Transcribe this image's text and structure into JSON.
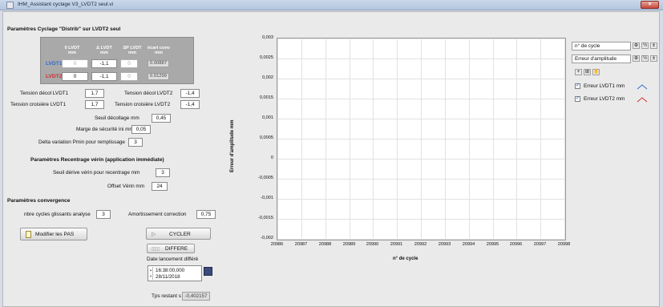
{
  "window": {
    "title": "IHM_Assistant cyclage V3_LVDT2 seul.vi",
    "close_glyph": "×"
  },
  "cycle": {
    "title": "Paramètres Cyclage \"Distrib\" sur LVDT2 seul",
    "table": {
      "headers": [
        "0 LVDT mm",
        "Δ LVDT mm",
        "SP LVDT mm",
        "écart conv mm"
      ],
      "rows": [
        {
          "label": "LVDT1",
          "zero": "0",
          "delta": "-1,1",
          "sp": "0",
          "ecart": "0.00887"
        },
        {
          "label": "LVDT2",
          "zero": "0",
          "delta": "-1,1",
          "sp": "0",
          "ecart": "0.01299"
        }
      ]
    },
    "tension_decol_1_label": "Tension décol LVDT1",
    "tension_decol_1": "1,7",
    "tension_decol_2_label": "Tension décol LVDT2",
    "tension_decol_2": "-1,4",
    "tension_crois_1_label": "Tension croisière LVDT1",
    "tension_crois_1": "1,7",
    "tension_crois_2_label": "Tension croisière LVDT2",
    "tension_crois_2": "-1,4",
    "seuil_label": "Seuil décollage mm",
    "seuil": "0,45",
    "marge_label": "Marge de sécurité ini mm",
    "marge": "0,05",
    "delta_label": "Delta variation Pmin pour remplissage",
    "delta": "3"
  },
  "verin": {
    "title": "Paramètres Recentrage vérin (application immédiate)",
    "seuil_label": "Seuil dérive vérin pour recentrage mm",
    "seuil": "3",
    "offset_label": "Offset Vérin mm",
    "offset": "24"
  },
  "convergence": {
    "title": "Paramètres convergence",
    "nbre_label": "nbre cycles glissants analyse",
    "nbre": "3",
    "amort_label": "Amortissement correction",
    "amort": "0,75"
  },
  "buttons": {
    "modifier": "Modifier les PAS",
    "cycler": "CYCLER",
    "differe": "DIFFERE"
  },
  "date": {
    "label": "Date lancement différé",
    "time": "16:38:00,000",
    "day": "28/11/2018"
  },
  "tps": {
    "label": "Tps restant s",
    "value": "-0,402157"
  },
  "side": {
    "x_selector": "n° de cycle",
    "y_selector": "Erreur d'amplitude",
    "legend": [
      {
        "name": "Erreur LVDT1 mm",
        "color": "#2f6fd0",
        "checked": true
      },
      {
        "name": "Erreur LVDT2 mm",
        "color": "#d03030",
        "checked": true
      }
    ]
  },
  "chart_data": {
    "type": "line",
    "title": "",
    "xlabel": "n° de cycle",
    "ylabel": "Erreur d'amplitude mm",
    "xlim": [
      20986,
      20998
    ],
    "ylim": [
      -0.002,
      0.003
    ],
    "x_ticks": [
      "20986",
      "20987",
      "20988",
      "20989",
      "20990",
      "20991",
      "20992",
      "20993",
      "20994",
      "20995",
      "20996",
      "20997",
      "20998"
    ],
    "y_ticks": [
      "0,003",
      "0,0025",
      "0,002",
      "0,0015",
      "0,001",
      "0,0005",
      "0",
      "-0,0005",
      "-0,001",
      "-0,0015",
      "-0,002"
    ],
    "grid": true,
    "series": [
      {
        "name": "Erreur LVDT1 mm",
        "values": []
      },
      {
        "name": "Erreur LVDT2 mm",
        "values": []
      }
    ]
  }
}
